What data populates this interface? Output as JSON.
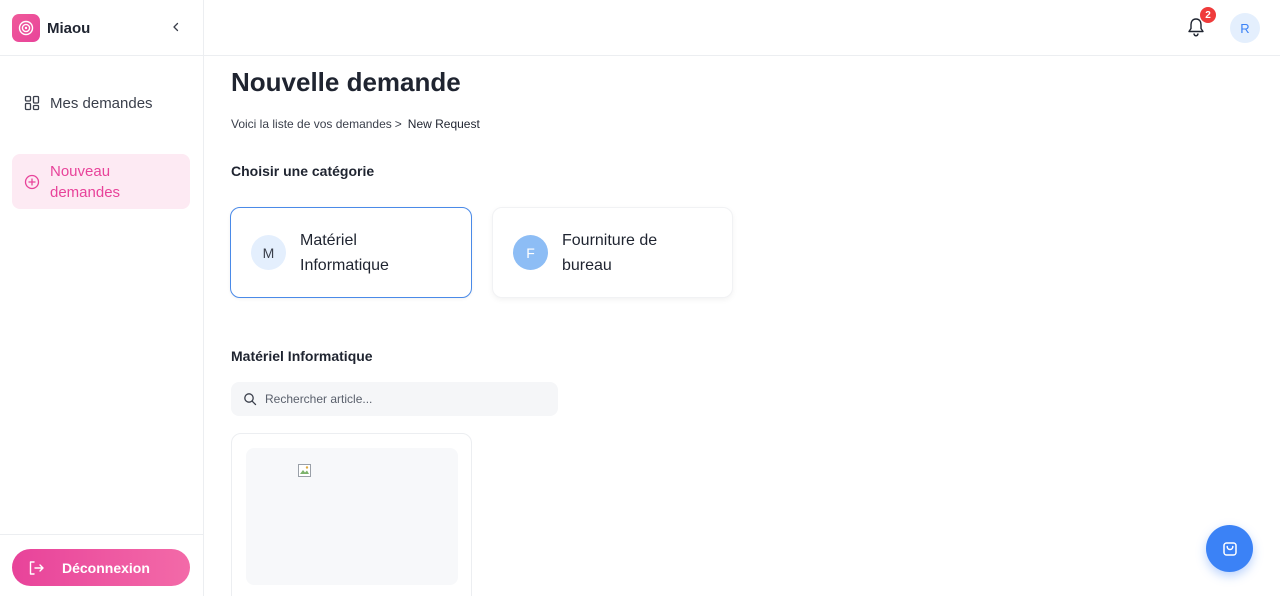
{
  "app": {
    "name": "Miaou"
  },
  "sidebar": {
    "items": [
      {
        "label": "Mes demandes",
        "icon": "grid-icon",
        "active": false
      },
      {
        "label": "Nouveau demandes",
        "icon": "plus-circle-icon",
        "active": true
      }
    ],
    "logout_label": "Déconnexion"
  },
  "header": {
    "notification_count": "2",
    "avatar_initial": "R"
  },
  "main": {
    "title": "Nouvelle demande",
    "breadcrumb": {
      "link": "Voici la liste de vos demandes",
      "separator": ">",
      "current": "New Request"
    },
    "choose_category_label": "Choisir une catégorie",
    "categories": [
      {
        "initial": "M",
        "name": "Matériel Informatique",
        "selected": true
      },
      {
        "initial": "F",
        "name": "Fourniture de bureau",
        "selected": false
      }
    ],
    "section_title": "Matériel Informatique",
    "search": {
      "placeholder": "Rechercher article...",
      "value": ""
    }
  },
  "colors": {
    "brand_pink": "#e8439a",
    "accent_blue": "#3b82f6",
    "selected_border": "#4a8ae8",
    "badge_red": "#ef3b3b"
  }
}
